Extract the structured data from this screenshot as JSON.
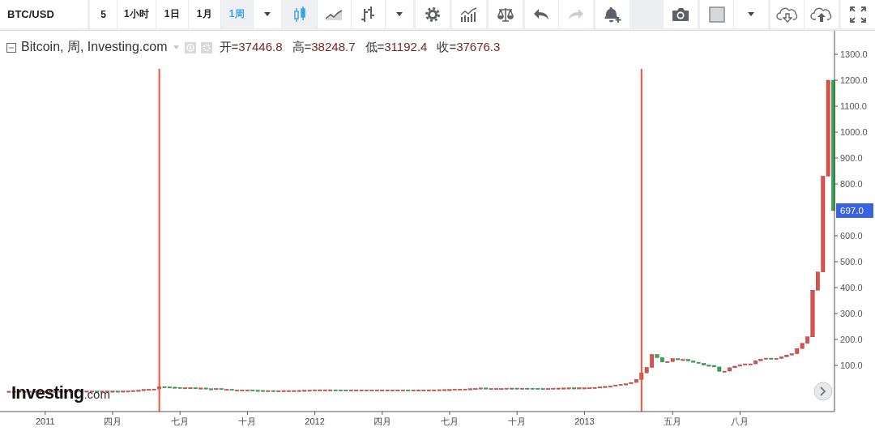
{
  "toolbar": {
    "symbol": "BTC/USD",
    "intervals": [
      {
        "label": "5",
        "selected": false
      },
      {
        "label": "1小时",
        "selected": false
      },
      {
        "label": "1日",
        "selected": false
      },
      {
        "label": "1月",
        "selected": false
      },
      {
        "label": "1周",
        "selected": true
      }
    ],
    "chart_types": [
      {
        "kind": "candles",
        "selected": true
      },
      {
        "kind": "area",
        "selected": false
      },
      {
        "kind": "bars",
        "selected": false
      }
    ],
    "tools_left": [
      [
        {
          "kind": "settings",
          "disabled": false
        }
      ],
      [
        {
          "kind": "indicators",
          "disabled": false
        }
      ],
      [
        {
          "kind": "scales",
          "disabled": false
        }
      ],
      [
        {
          "kind": "undo",
          "disabled": false
        },
        {
          "kind": "redo",
          "disabled": true
        }
      ],
      [
        {
          "kind": "alert",
          "disabled": false
        }
      ]
    ],
    "tools_right": [
      [
        {
          "kind": "camera"
        }
      ],
      [
        {
          "kind": "color"
        },
        {
          "kind": "caret"
        }
      ],
      [
        {
          "kind": "cloud-download"
        },
        {
          "kind": "cloud-upload"
        }
      ],
      [
        {
          "kind": "fullscreen"
        }
      ]
    ]
  },
  "legend": {
    "title": "Bitcoin, 周, Investing.com",
    "values": [
      {
        "label": "开=",
        "value": "37446.8"
      },
      {
        "label": "高=",
        "value": "38248.7"
      },
      {
        "label": "低=",
        "value": "31192.4"
      },
      {
        "label": "收=",
        "value": "37676.3"
      }
    ]
  },
  "logo_name": "Investing",
  "logo_suffix": ".com",
  "price_label": "697.0",
  "price_axis": [
    "1300.0",
    "1200.0",
    "1100.0",
    "1000.0",
    "900.0",
    "800.0",
    "600.0",
    "500.0",
    "400.0",
    "300.0",
    "200.0",
    "100.0"
  ],
  "time_axis": [
    "2011",
    "四月",
    "七月",
    "十月",
    "2012",
    "四月",
    "七月",
    "十月",
    "2013",
    "五月",
    "八月"
  ]
}
